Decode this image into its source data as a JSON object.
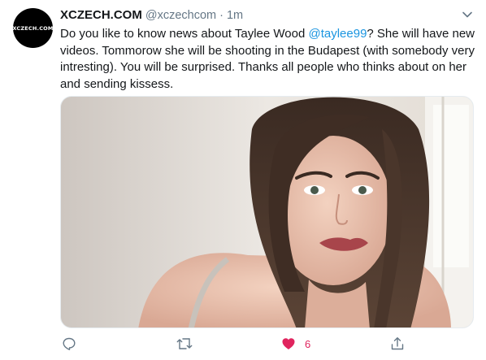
{
  "tweet": {
    "avatar_text": "XCZECH.COM",
    "display_name": "XCZECH.COM",
    "handle": "@xczechcom",
    "separator": "·",
    "time": "1m",
    "text_part1": "Do you like to know news about Taylee Wood ",
    "mention": "@taylee99",
    "text_part2": "? She will have new videos. Tommorow she will be shooting in the Budapest (with somebody very intresting). You will be surprised. Thanks all people who thinks about on her and sending kissess.",
    "like_count": "6"
  },
  "icons": {
    "more": "chevron-down-icon",
    "reply": "reply-bubble-icon",
    "retweet": "retweet-icon",
    "like": "heart-icon",
    "share": "share-icon"
  },
  "colors": {
    "link": "#1b95e0",
    "muted": "#657786",
    "like_active": "#e0245e",
    "avatar_bg": "#000000"
  }
}
